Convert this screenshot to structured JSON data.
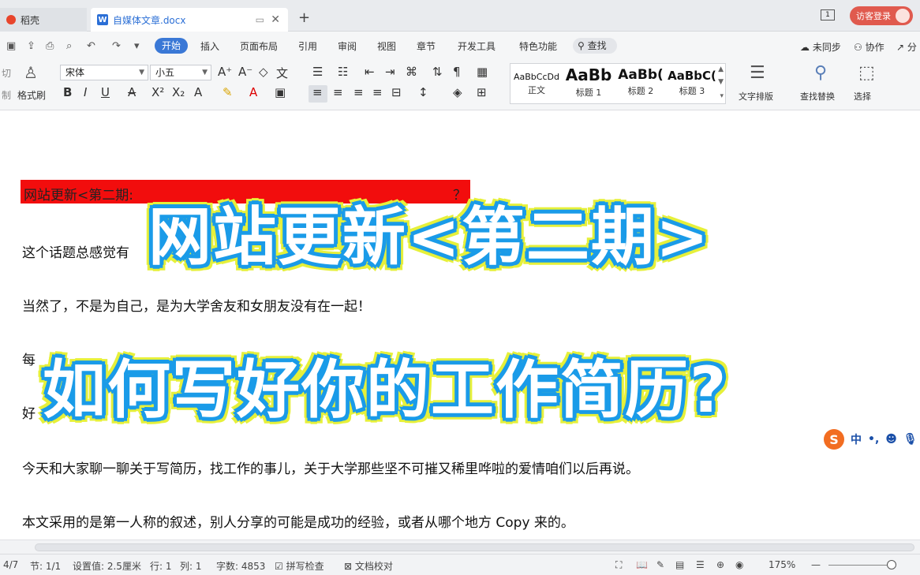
{
  "tabs": [
    {
      "label": "稻壳"
    },
    {
      "label": "自媒体文章.docx"
    }
  ],
  "tabbar": {
    "new_tab": "+",
    "window_icon": "1",
    "login_label": "访客登录"
  },
  "quick_access": [
    "⎙",
    "↶",
    "↷"
  ],
  "menu": {
    "items": [
      "开始",
      "插入",
      "页面布局",
      "引用",
      "审阅",
      "视图",
      "章节",
      "开发工具",
      "特色功能"
    ],
    "search": "查找",
    "right": [
      "未同步",
      "协作",
      "分"
    ]
  },
  "ribbon": {
    "clipboard": {
      "cut_label": "切",
      "paint_label": "格式刷",
      "cut_sub": "制"
    },
    "font_name": "宋体",
    "font_size": "小五",
    "styles": [
      {
        "sample": "AaBbCcDd",
        "name": "正文"
      },
      {
        "sample": "AaBb",
        "name": "标题 1"
      },
      {
        "sample": "AaBb(",
        "name": "标题 2"
      },
      {
        "sample": "AaBbC(",
        "name": "标题 3"
      }
    ],
    "text_layout": "文字排版",
    "find_replace": "查找替换",
    "select": "选择"
  },
  "document": {
    "heading_highlight": "网站更新<第二期:",
    "heading_tail": "？",
    "paragraphs": [
      "这个话题总感觉有",
      "当然了，不是为自己，是为大学舍友和女朋友没有在一起！",
      "每",
      "好",
      "今天和大家聊一聊关于写简历，找工作的事儿，关于大学那些坚不可摧又稀里哗啦的爱情咱们以后再说。",
      "本文采用的是第一人称的叙述，别人分享的可能是成功的经验，或者从哪个地方 Copy 来的。"
    ]
  },
  "overlay": {
    "line1": "网站更新<第二期>",
    "line2": "如何写好你的工作简历?"
  },
  "ime": {
    "logo": "S",
    "mode": "中"
  },
  "status": {
    "page": "4/7",
    "section": "节: 1/1",
    "setting": "设置值: 2.5厘米",
    "row": "行: 1",
    "col": "列: 1",
    "words": "字数: 4853",
    "spell": "拼写检查",
    "proof": "文档校对",
    "zoom": "175%"
  },
  "colors": {
    "accent": "#3a78d6",
    "highlight": "#f20d0d",
    "overlay_stroke": "#1a9be8",
    "overlay_glow": "#e6f03a"
  }
}
